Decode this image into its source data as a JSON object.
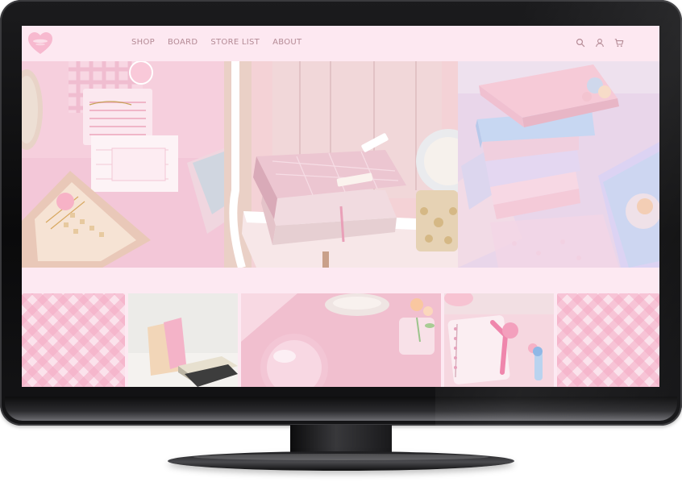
{
  "nav": {
    "items": [
      "SHOP",
      "BOARD",
      "STORE LIST",
      "ABOUT"
    ]
  },
  "header_icons": [
    "search-icon",
    "user-icon",
    "cart-icon"
  ],
  "colors": {
    "header_bg": "#fde8f1",
    "nav_text": "#b48a95",
    "logo_heart": "#f7b9cf",
    "page_bg": "#fde9f2",
    "bezel": "#0f0f10"
  }
}
